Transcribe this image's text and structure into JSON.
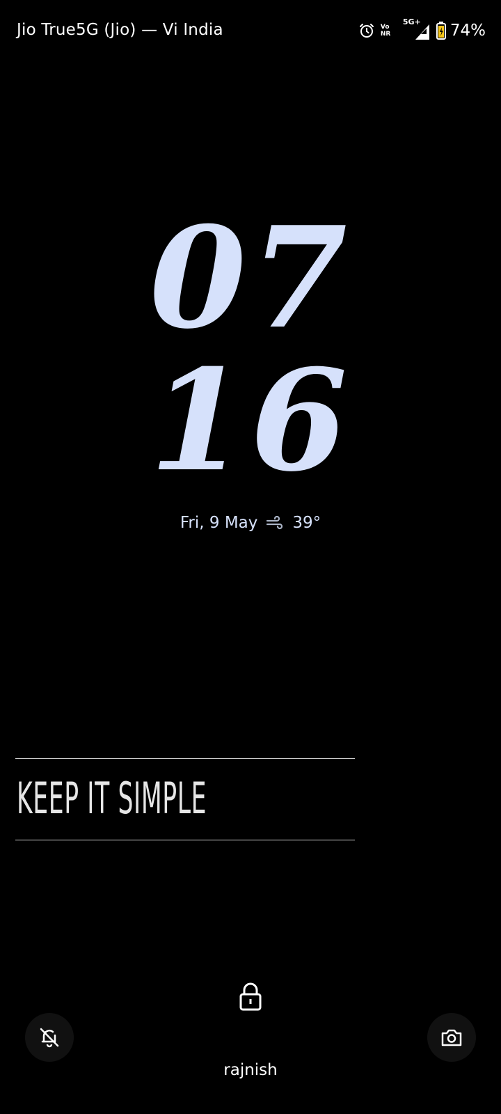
{
  "status_bar": {
    "carrier": "Jio True5G (Jio) — Vi India",
    "network_badge_top": "Vo",
    "network_badge_bottom": "NR",
    "network_type": "5G+",
    "battery_percent": "74%",
    "icons": [
      "alarm-icon",
      "volte-icon",
      "signal-icon",
      "battery-icon"
    ]
  },
  "clock": {
    "hours": "07",
    "minutes": "16"
  },
  "date_weather": {
    "date": "Fri, 9 May",
    "weather_icon": "wind-icon",
    "temperature": "39°"
  },
  "widget": {
    "text": "KEEP IT SIMPLE"
  },
  "bottom": {
    "owner_name": "rajnish",
    "icons": [
      "lock-icon",
      "bell-off-icon",
      "camera-icon"
    ]
  },
  "colors": {
    "background": "#000000",
    "clock_color": "#d6e1fb",
    "text": "#ffffff",
    "button_bg": "#111111"
  }
}
